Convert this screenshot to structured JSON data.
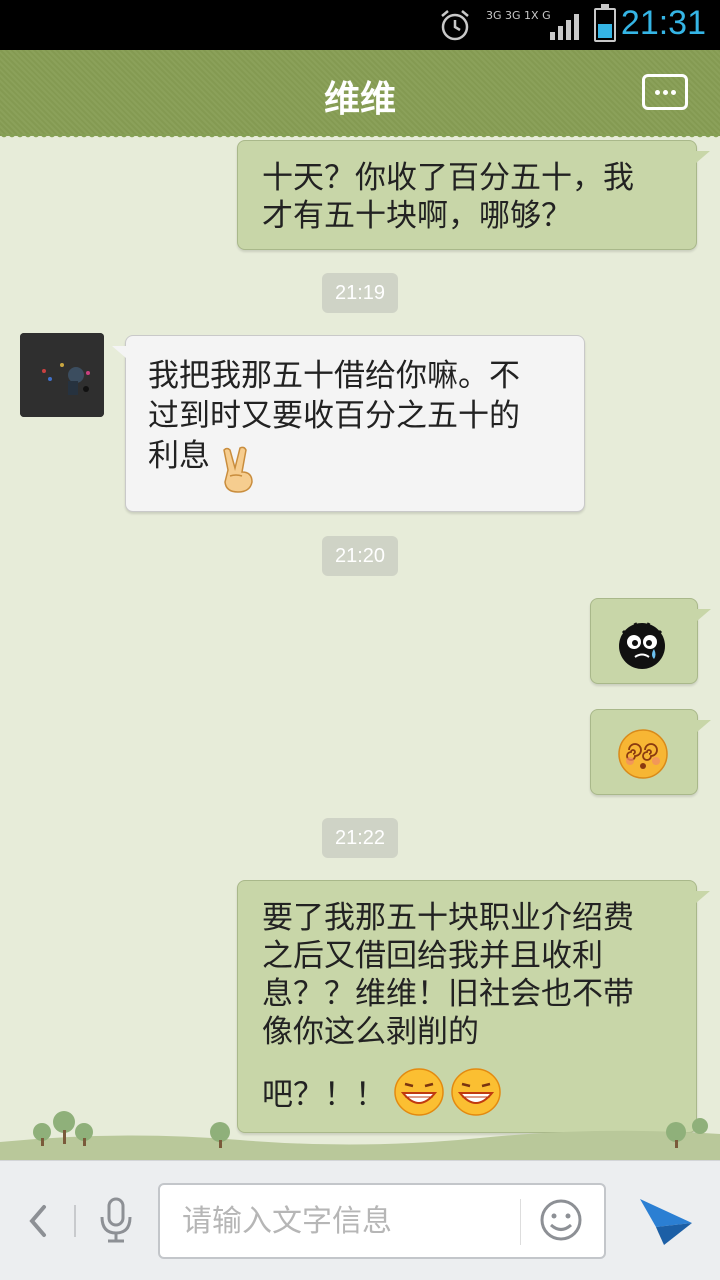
{
  "status_bar": {
    "time": "21:31",
    "network": "3G 3G 1X G"
  },
  "header": {
    "title": "维维"
  },
  "messages": [
    {
      "side": "out",
      "text": "十天？你收了百分五十，我\n才有五十块啊，哪够？"
    },
    {
      "side": "time",
      "text": "21:19"
    },
    {
      "side": "in",
      "text": "我把我那五十借给你嘛。不\n过到时又要收百分之五十的\n利息"
    },
    {
      "side": "time",
      "text": "21:20"
    },
    {
      "side": "out",
      "emoji": "crying-face"
    },
    {
      "side": "out",
      "emoji": "dizzy-face"
    },
    {
      "side": "time",
      "text": "21:22"
    },
    {
      "side": "out",
      "text": "要了我那五十块职业介绍费\n之后又借回给我并且收利\n息？？维维！旧社会也不带\n像你这么剥削的",
      "tail": "吧？！！"
    }
  ],
  "input": {
    "placeholder": "请输入文字信息"
  },
  "colors": {
    "header": "#86a055",
    "outgoing_bubble": "#c8d6a8",
    "incoming_bubble": "#f4f4f4",
    "background": "#e7ecd9",
    "send": "#2b7fd3"
  }
}
